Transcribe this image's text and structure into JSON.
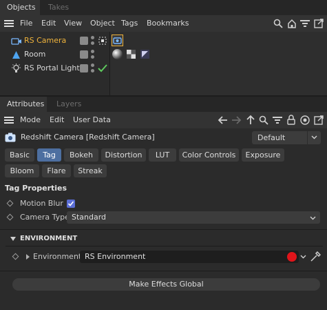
{
  "objects_panel": {
    "tabs": [
      {
        "label": "Objects"
      },
      {
        "label": "Takes"
      }
    ],
    "menu": [
      {
        "label": "File"
      },
      {
        "label": "Edit"
      },
      {
        "label": "View"
      },
      {
        "label": "Object"
      },
      {
        "label": "Tags"
      },
      {
        "label": "Bookmarks"
      }
    ],
    "objects": [
      {
        "name": "RS Camera",
        "selected": true
      },
      {
        "name": "Room",
        "selected": false
      },
      {
        "name": "RS Portal Light",
        "selected": false
      }
    ]
  },
  "attributes_panel": {
    "tabs": [
      {
        "label": "Attributes"
      },
      {
        "label": "Layers"
      }
    ],
    "menu": [
      {
        "label": "Mode"
      },
      {
        "label": "Edit"
      },
      {
        "label": "User Data"
      }
    ],
    "object_title": "Redshift Camera [Redshift Camera]",
    "preset": "Default",
    "tag_buttons_row1": [
      {
        "label": "Basic",
        "selected": false
      },
      {
        "label": "Tag",
        "selected": true
      },
      {
        "label": "Bokeh",
        "selected": false
      },
      {
        "label": "Distortion",
        "selected": false
      },
      {
        "label": "LUT",
        "selected": false
      },
      {
        "label": "Color Controls",
        "selected": false
      },
      {
        "label": "Exposure",
        "selected": false
      }
    ],
    "tag_buttons_row2": [
      {
        "label": "Bloom",
        "selected": false
      },
      {
        "label": "Flare",
        "selected": false
      },
      {
        "label": "Streak",
        "selected": false
      }
    ],
    "section_title": "Tag Properties",
    "motion_blur_label": "Motion Blur",
    "motion_blur_checked": true,
    "camera_type_label": "Camera Type",
    "camera_type_value": "Standard",
    "environment_group": "ENVIRONMENT",
    "environment_label": "Environment",
    "environment_value": "RS Environment",
    "global_button": "Make Effects Global"
  },
  "colors": {
    "accent_selected": "#f0b43c",
    "tab_selected_blue": "#4d6fa0",
    "check_green": "#5ec95e",
    "env_red": "#e0141a"
  }
}
